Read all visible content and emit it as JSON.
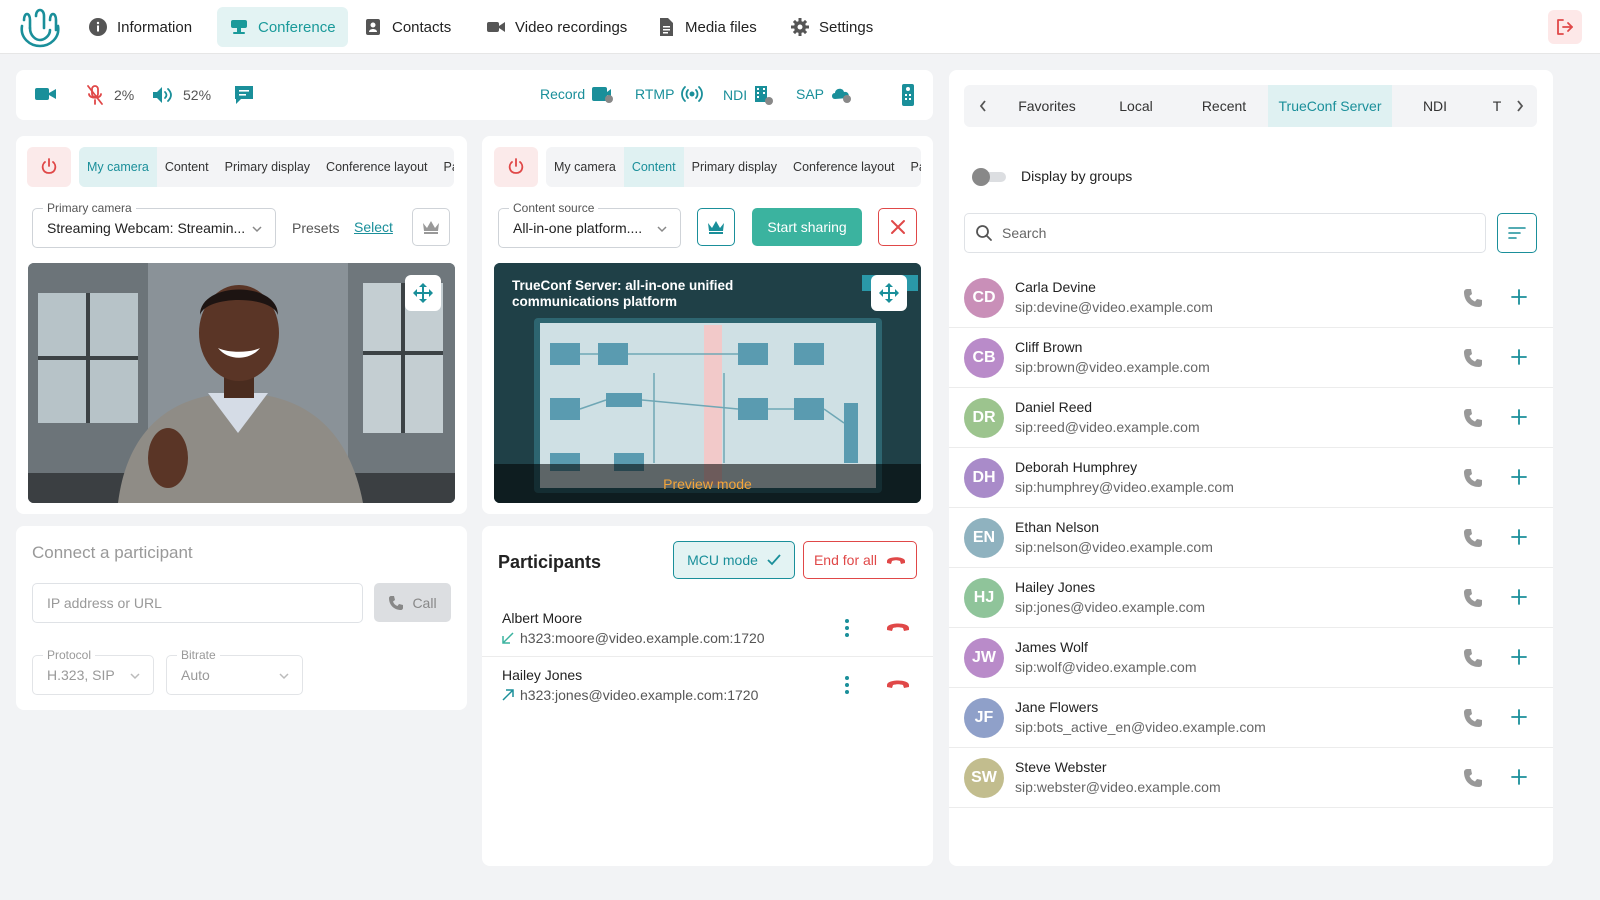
{
  "nav": {
    "items": [
      {
        "label": "Information",
        "icon": "info-icon"
      },
      {
        "label": "Conference",
        "icon": "conference-icon",
        "active": true
      },
      {
        "label": "Contacts",
        "icon": "contacts-icon"
      },
      {
        "label": "Video recordings",
        "icon": "video-recordings-icon"
      },
      {
        "label": "Media files",
        "icon": "media-files-icon"
      },
      {
        "label": "Settings",
        "icon": "gear-icon"
      }
    ]
  },
  "controls": {
    "mic_level": "2%",
    "speaker_level": "52%",
    "record_label": "Record",
    "rtmp_label": "RTMP",
    "ndi_label": "NDI",
    "sap_label": "SAP"
  },
  "left_panel": {
    "tabs": [
      "My camera",
      "Content",
      "Primary display",
      "Conference layout",
      "Parti"
    ],
    "active_tab": "My camera",
    "camera_legend": "Primary camera",
    "camera_value": "Streaming Webcam: Streamin...",
    "presets_label": "Presets",
    "select_label": "Select"
  },
  "right_panel": {
    "tabs": [
      "My camera",
      "Content",
      "Primary display",
      "Conference layout",
      "Parti"
    ],
    "active_tab": "Content",
    "source_legend": "Content source",
    "source_value": "All-in-one platform....",
    "start_sharing": "Start sharing",
    "slide_title_line1": "TrueConf Server: all-in-one unified",
    "slide_title_line2": "communications platform",
    "preview_label": "Preview mode"
  },
  "connect": {
    "title": "Connect a participant",
    "address_placeholder": "IP address or URL",
    "call_label": "Call",
    "protocol_legend": "Protocol",
    "protocol_value": "H.323, SIP",
    "bitrate_legend": "Bitrate",
    "bitrate_value": "Auto"
  },
  "participants": {
    "title": "Participants",
    "mcu_label": "MCU mode",
    "end_label": "End for all",
    "items": [
      {
        "name": "Albert Moore",
        "address": "h323:moore@video.example.com:1720",
        "direction": "incoming"
      },
      {
        "name": "Hailey Jones",
        "address": "h323:jones@video.example.com:1720",
        "direction": "outgoing"
      }
    ]
  },
  "address_book": {
    "tabs": [
      "Favorites",
      "Local",
      "Recent",
      "TrueConf Server",
      "NDI",
      "T"
    ],
    "active_tab": "TrueConf Server",
    "display_groups_label": "Display by groups",
    "search_placeholder": "Search",
    "contacts": [
      {
        "initials": "CD",
        "name": "Carla Devine",
        "sip": "sip:devine@video.example.com",
        "color": "#c98fb8"
      },
      {
        "initials": "CB",
        "name": "Cliff Brown",
        "sip": "sip:brown@video.example.com",
        "color": "#b98bc9"
      },
      {
        "initials": "DR",
        "name": "Daniel Reed",
        "sip": "sip:reed@video.example.com",
        "color": "#9cc48e"
      },
      {
        "initials": "DH",
        "name": "Deborah Humphrey",
        "sip": "sip:humphrey@video.example.com",
        "color": "#a98bc9"
      },
      {
        "initials": "EN",
        "name": "Ethan Nelson",
        "sip": "sip:nelson@video.example.com",
        "color": "#8fb2bf"
      },
      {
        "initials": "HJ",
        "name": "Hailey Jones",
        "sip": "sip:jones@video.example.com",
        "color": "#8fc49a"
      },
      {
        "initials": "JW",
        "name": "James Wolf",
        "sip": "sip:wolf@video.example.com",
        "color": "#b98bc9"
      },
      {
        "initials": "JF",
        "name": "Jane Flowers",
        "sip": "sip:bots_active_en@video.example.com",
        "color": "#8fa0c9"
      },
      {
        "initials": "SW",
        "name": "Steve Webster",
        "sip": "sip:webster@video.example.com",
        "color": "#c2bd8e"
      }
    ]
  },
  "colors": {
    "accent": "#1a8f9a",
    "danger": "#e04848",
    "share_button": "#3bb39f"
  }
}
